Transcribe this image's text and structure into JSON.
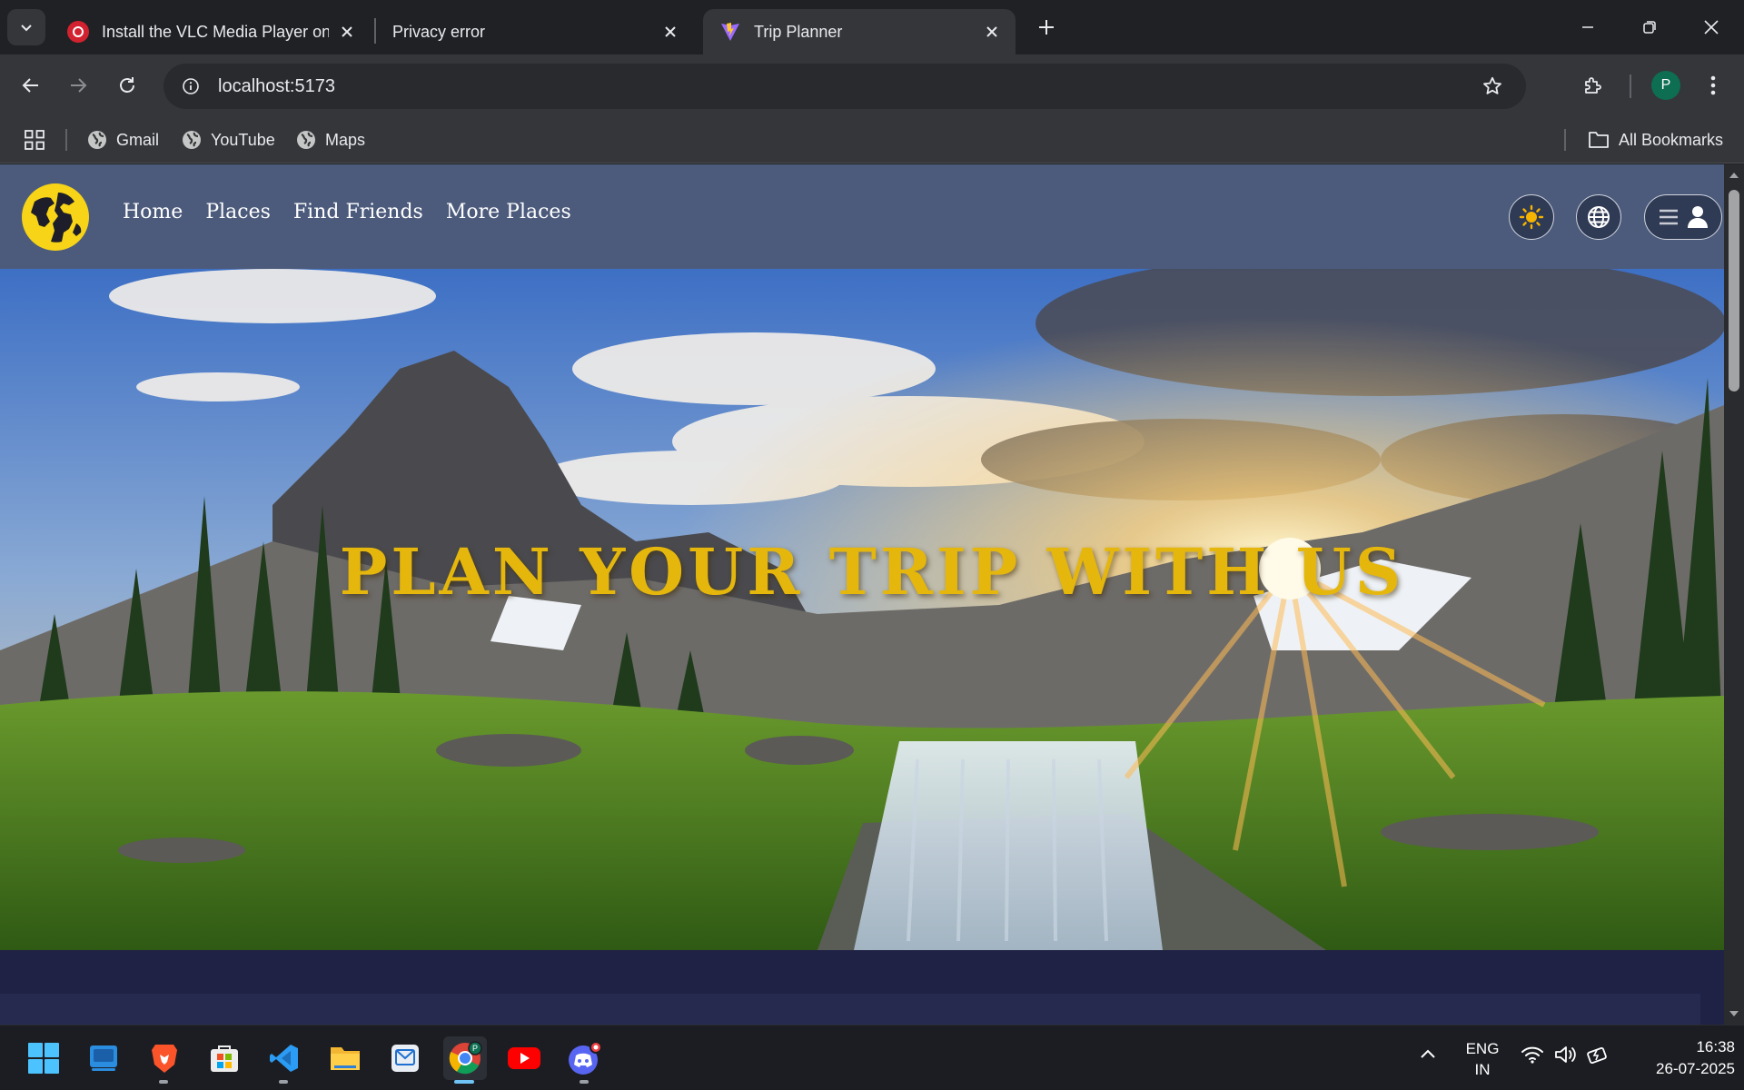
{
  "browser": {
    "tabs": [
      {
        "title": "Install the VLC Media Player on",
        "favicon": "red-logo-icon",
        "active": false
      },
      {
        "title": "Privacy error",
        "favicon": "none",
        "active": false
      },
      {
        "title": "Trip Planner",
        "favicon": "vite-logo-icon",
        "active": true
      }
    ],
    "address": "localhost:5173",
    "profile_initial": "P",
    "bookmarks": [
      {
        "label": "Gmail",
        "icon": "globe-icon"
      },
      {
        "label": "YouTube",
        "icon": "globe-icon"
      },
      {
        "label": "Maps",
        "icon": "globe-icon"
      }
    ],
    "all_bookmarks": "All Bookmarks"
  },
  "site": {
    "nav": [
      "Home",
      "Places",
      "Find Friends",
      "More Places"
    ],
    "buttons": {
      "theme": "sun-icon",
      "language": "globe-icon",
      "account": "menu-user-icon"
    },
    "hero_title": "PLAN YOUR TRIP WITH US",
    "colors": {
      "nav_bg": "#4c5b7c",
      "page_bg": "#1f2244",
      "title": "#e5b70c",
      "logo": "#f7d417"
    }
  },
  "taskbar": {
    "apps": [
      "windows-start-icon",
      "widgets-icon",
      "brave-icon",
      "microsoft-store-icon",
      "vscode-icon",
      "file-explorer-icon",
      "app-icon",
      "chrome-icon",
      "youtube-icon",
      "discord-icon"
    ],
    "language": {
      "line1": "ENG",
      "line2": "IN"
    },
    "time": "16:38",
    "date": "26-07-2025"
  }
}
